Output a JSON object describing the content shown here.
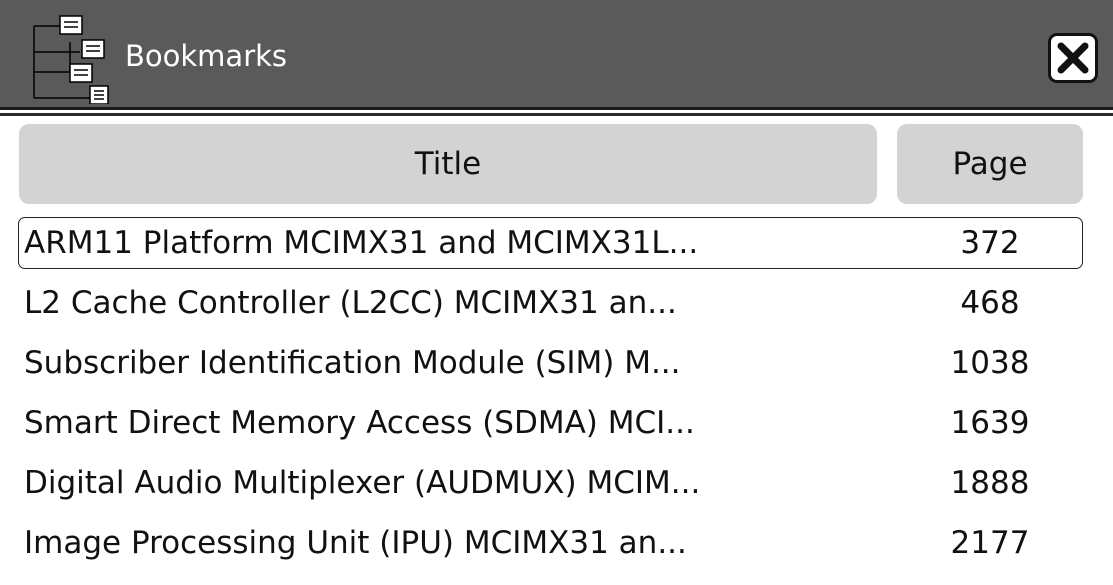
{
  "window": {
    "title": "Bookmarks",
    "icon": "bookmark-tree-icon",
    "close_icon": "close-icon"
  },
  "table": {
    "columns": [
      "Title",
      "Page"
    ],
    "rows": [
      {
        "title": "ARM11 Platform MCIMX31 and MCIMX31L...",
        "page": "372",
        "selected": true
      },
      {
        "title": "L2 Cache Controller (L2CC) MCIMX31 an...",
        "page": "468"
      },
      {
        "title": "Subscriber Identification Module (SIM) M...",
        "page": "1038"
      },
      {
        "title": "Smart Direct Memory Access (SDMA) MCI...",
        "page": "1639"
      },
      {
        "title": "Digital Audio Multiplexer (AUDMUX) MCIM...",
        "page": "1888"
      },
      {
        "title": "Image Processing Unit (IPU) MCIMX31 an...",
        "page": "2177"
      }
    ]
  },
  "colors": {
    "titlebar": "#5a5a5a",
    "header": "#d3d3d3",
    "text": "#111111"
  }
}
